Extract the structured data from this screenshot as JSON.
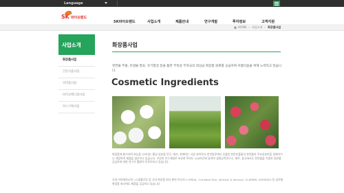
{
  "topbar": {
    "language": "Language"
  },
  "header": {
    "logo_sk": "SK",
    "logo_text": "바이오랜드",
    "nav": [
      "SK바이오랜드",
      "사업소개",
      "제품안내",
      "연구개발",
      "투자정보",
      "고객지원"
    ]
  },
  "breadcrumb": {
    "home": "HOME",
    "level1": "사업소개",
    "current": "화장품사업"
  },
  "sidebar": {
    "title": "사업소개",
    "items": [
      "화장품사업",
      "건강식품사업",
      "의약품사업",
      "바이오메디컬사업",
      "마스크팩사업"
    ]
  },
  "main": {
    "title": "화장품사업",
    "intro": "천연물 추출, 미생물 발효, 유기합성 등을 통한 무독성 무자극의 최상급 화장품 원료를 공급하여 아름다움을 위해 노력하고 있습니다.",
    "heading_en": "Cosmetic Ingredients",
    "body1": "화장품에 쓸거리며 효능을 나타내는 활성 성분을 연구, 제조, 판매하는 사업 분야로서 천연원료에서 추출한 천연추출물과 천연물의 주요성분만을 정제하거나 개량하여 제품을 생산하고 있습니다. 꾸준한 연구개발로 보유한 특허도 100여건에 달하며 생명공학연구소, 제주, 중국에서도 천연물을 이용한 원료를 공급하여 대한 연구가 활발히 이루어지고 있습니다.",
    "body2": "국내 아모레퍼시픽, LG생활건강 등 국내 화장품 회사 뿐만 아니라 L'OREAL, Christian Dior, Johnson & Johnson, CLARINS, SHISEIDO 등 글로벌 화장품 회사에도 제품을 공급하고 있습니다."
  },
  "colors": {
    "accent": "#25a45b",
    "topbar": "#2f2f2f",
    "brand_red": "#e0312c"
  },
  "icons": {
    "home": "home-icon",
    "menu": "hamburger-icon"
  }
}
